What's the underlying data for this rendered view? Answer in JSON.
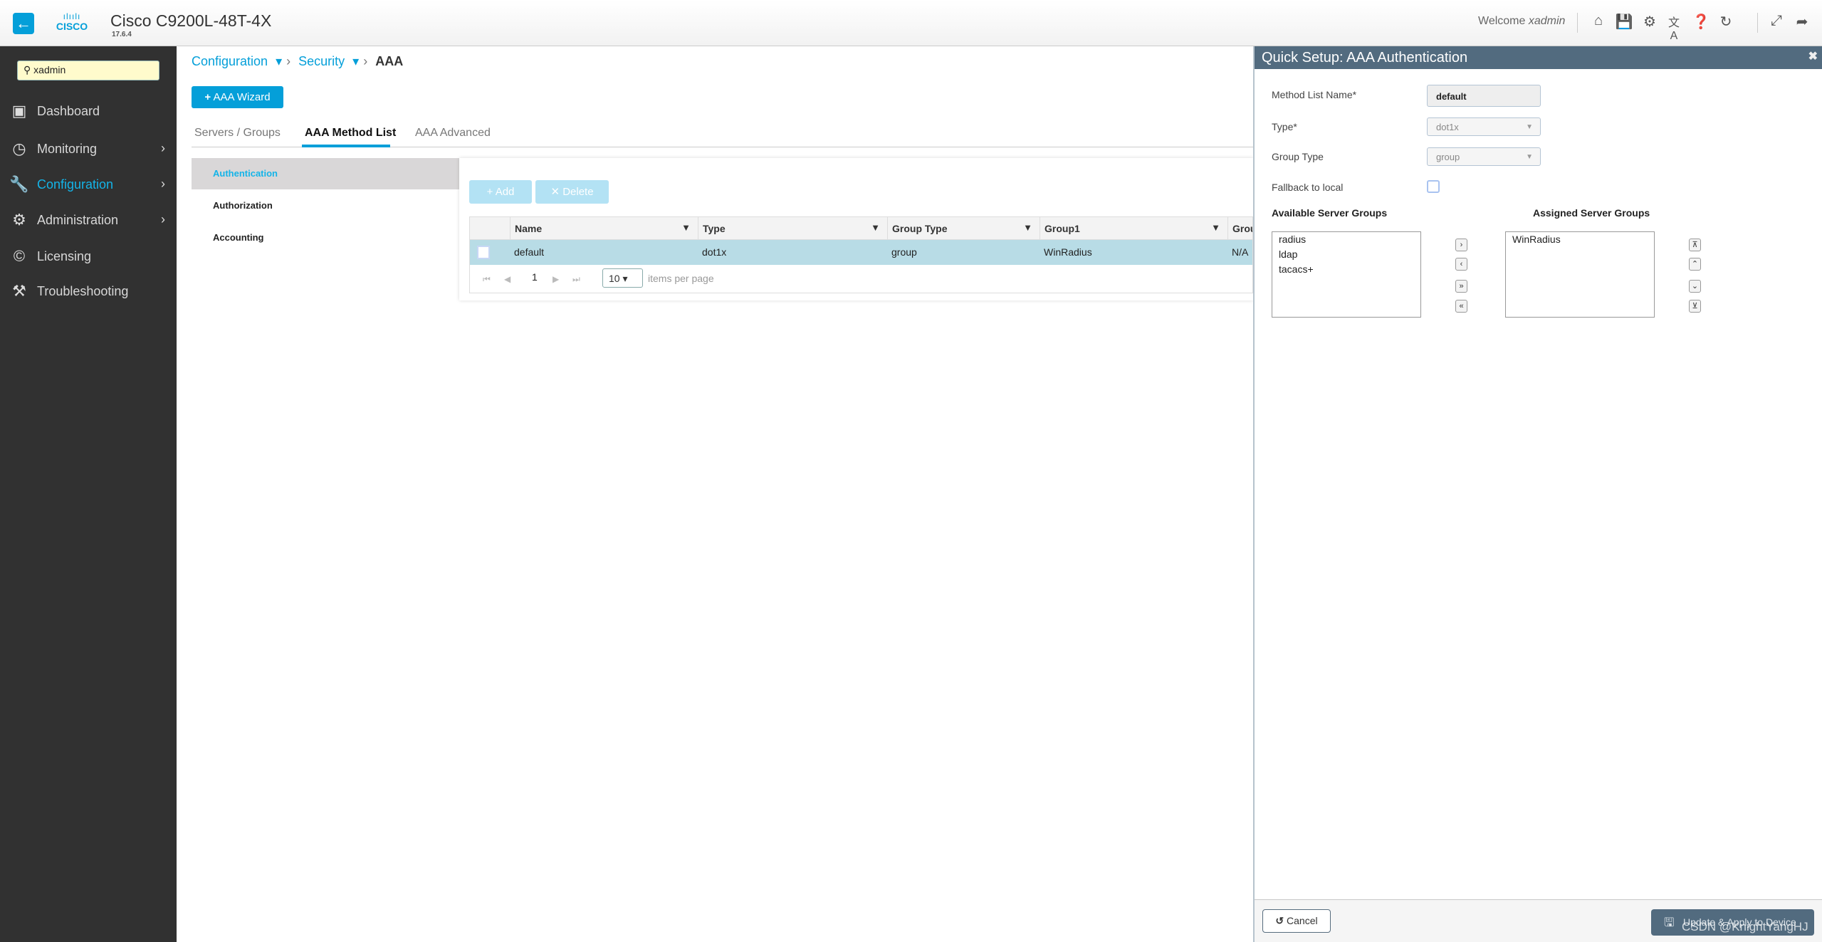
{
  "header": {
    "title": "Cisco C9200L-48T-4X",
    "version": "17.6.4",
    "logo_text": "CISCO",
    "welcome": "Welcome",
    "user": "xadmin",
    "icons": [
      "home-icon",
      "save-icon",
      "gear-icon",
      "language-icon",
      "help-icon",
      "refresh-icon",
      "expand-icon",
      "logout-icon"
    ]
  },
  "sidebar": {
    "search_value": "xadmin",
    "items": [
      {
        "label": "Dashboard",
        "icon": "dashboard-icon"
      },
      {
        "label": "Monitoring",
        "icon": "gauge-icon",
        "chevron": true
      },
      {
        "label": "Configuration",
        "icon": "wrench-icon",
        "chevron": true,
        "active": true
      },
      {
        "label": "Administration",
        "icon": "gear-icon",
        "chevron": true
      },
      {
        "label": "Licensing",
        "icon": "license-icon"
      },
      {
        "label": "Troubleshooting",
        "icon": "tools-icon"
      }
    ]
  },
  "breadcrumb": {
    "items": [
      "Configuration",
      "Security"
    ],
    "current": "AAA"
  },
  "wizard_button": "AAA Wizard",
  "tabs": [
    "Servers / Groups",
    "AAA Method List",
    "AAA Advanced"
  ],
  "active_tab": "AAA Method List",
  "subnav": [
    "Authentication",
    "Authorization",
    "Accounting"
  ],
  "toolbar": {
    "add": "Add",
    "delete": "Delete"
  },
  "table": {
    "columns": [
      "Name",
      "Type",
      "Group Type",
      "Group1",
      "Grou"
    ],
    "rows": [
      [
        "default",
        "dot1x",
        "group",
        "WinRadius",
        "N/A"
      ]
    ],
    "page": "1",
    "per_page": "10",
    "per_page_label": "items per page"
  },
  "drawer": {
    "title": "Quick Setup: AAA Authentication",
    "method_list_name_label": "Method List Name*",
    "method_list_name": "default",
    "type_label": "Type*",
    "type_value": "dot1x",
    "group_type_label": "Group Type",
    "group_type_value": "group",
    "fallback_label": "Fallback to local",
    "fallback_checked": false,
    "available_label": "Available Server Groups",
    "available": [
      "radius",
      "ldap",
      "tacacs+"
    ],
    "assigned_label": "Assigned Server Groups",
    "assigned": [
      "WinRadius"
    ],
    "cancel": "Cancel",
    "apply": "Update & Apply to Device"
  },
  "watermark": "CSDN @KnightYangHJ",
  "colors": {
    "accent": "#049fd9",
    "sidebar": "#313131",
    "drawer_header": "#526b7f",
    "selected_row": "#b8dce6"
  }
}
